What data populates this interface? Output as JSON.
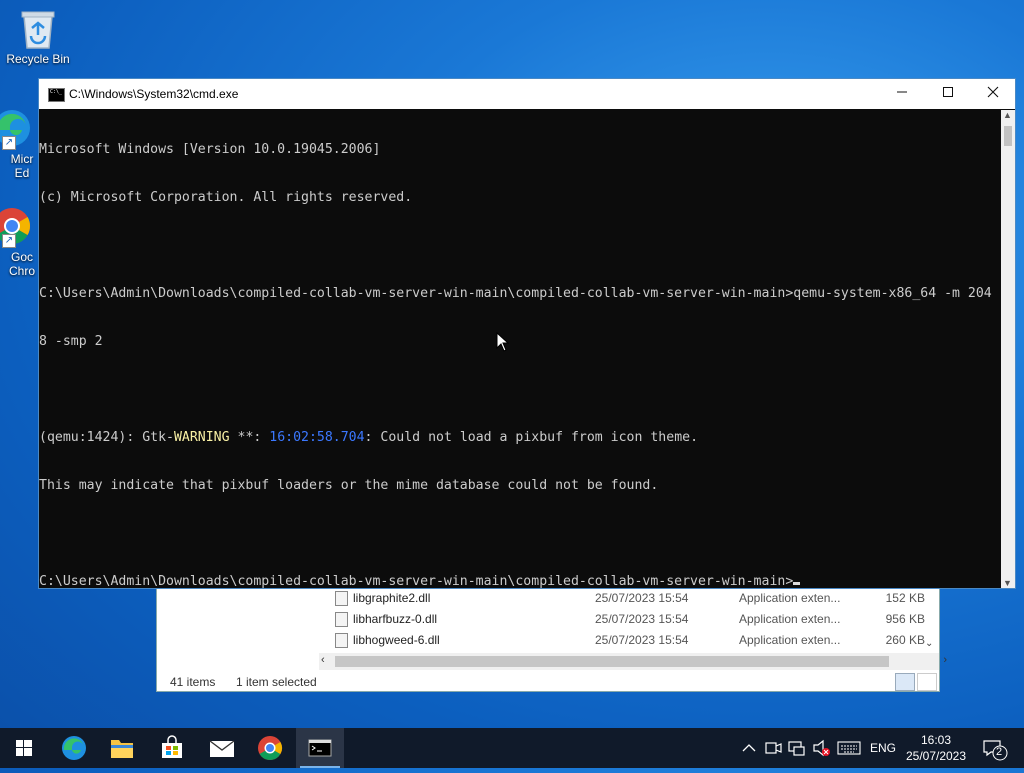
{
  "desktop": {
    "icons": [
      {
        "label": "Recycle Bin"
      },
      {
        "label": "Micr\nEd"
      },
      {
        "label": "Goc\nChro"
      }
    ]
  },
  "explorer": {
    "files": [
      {
        "name": "libgraphite2.dll",
        "date": "25/07/2023 15:54",
        "type": "Application exten...",
        "size": "152 KB"
      },
      {
        "name": "libharfbuzz-0.dll",
        "date": "25/07/2023 15:54",
        "type": "Application exten...",
        "size": "956 KB"
      },
      {
        "name": "libhogweed-6.dll",
        "date": "25/07/2023 15:54",
        "type": "Application exten...",
        "size": "260 KB"
      }
    ],
    "status": {
      "count": "41 items",
      "selected": "1 item selected"
    }
  },
  "cmd": {
    "title": "C:\\Windows\\System32\\cmd.exe",
    "lines": {
      "l1": "Microsoft Windows [Version 10.0.19045.2006]",
      "l2": "(c) Microsoft Corporation. All rights reserved.",
      "l3": "C:\\Users\\Admin\\Downloads\\compiled-collab-vm-server-win-main\\compiled-collab-vm-server-win-main>qemu-system-x86_64 -m 204",
      "l4": "8 -smp 2",
      "l5a": "(qemu:1424): Gtk-",
      "l5b": "WARNING",
      "l5c": " **: ",
      "l5d": "16:02:58.704",
      "l5e": ": Could not load a pixbuf from icon theme.",
      "l6": "This may indicate that pixbuf loaders or the mime database could not be found.",
      "l7": "C:\\Users\\Admin\\Downloads\\compiled-collab-vm-server-win-main\\compiled-collab-vm-server-win-main>"
    }
  },
  "taskbar": {
    "apps": [
      "start",
      "edge",
      "file-explorer",
      "store",
      "mail",
      "chrome",
      "cmd"
    ],
    "tray": {
      "language": "ENG",
      "notifications": "2"
    },
    "clock": {
      "time": "16:03",
      "date": "25/07/2023"
    }
  },
  "colors": {
    "accent": "#0c5fbf",
    "taskbar": "#101a2a",
    "console_bg": "#0c0c0c"
  }
}
